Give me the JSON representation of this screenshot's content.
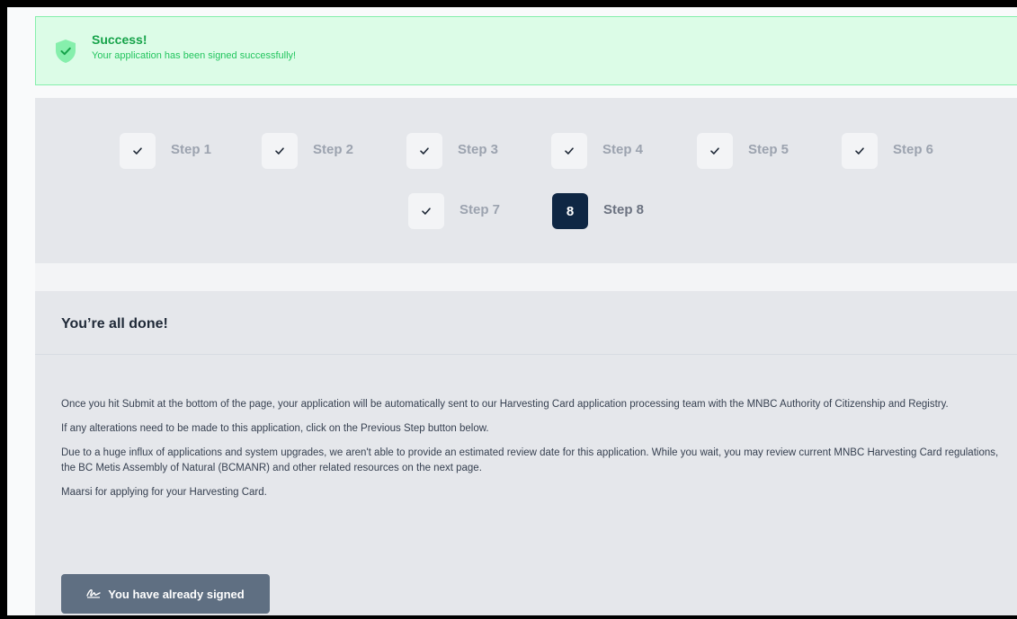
{
  "alert": {
    "title": "Success!",
    "message": "Your application has been signed successfully!",
    "icon": "shield-check-icon"
  },
  "steps": [
    {
      "label": "Step 1",
      "status": "complete"
    },
    {
      "label": "Step 2",
      "status": "complete"
    },
    {
      "label": "Step 3",
      "status": "complete"
    },
    {
      "label": "Step 4",
      "status": "complete"
    },
    {
      "label": "Step 5",
      "status": "complete"
    },
    {
      "label": "Step 6",
      "status": "complete"
    },
    {
      "label": "Step 7",
      "status": "complete"
    },
    {
      "label": "Step 8",
      "status": "current",
      "number": "8"
    }
  ],
  "done": {
    "title": "You’re all done!",
    "paragraphs": [
      "Once you hit Submit at the bottom of the page, your application will be automatically sent to our Harvesting Card application processing team with the MNBC Authority of Citizenship and Registry.",
      "If any alterations need to be made to this application, click on the Previous Step button below.",
      "Due to a huge influx of applications and system upgrades, we aren't able to provide an estimated review date for this application. While you wait, you may review current MNBC Harvesting Card regulations, the BC Metis Assembly of Natural (BCMANR) and other related resources on the next page.",
      "Maarsi for applying for your Harvesting Card."
    ],
    "signed_button": "You have already signed",
    "signed_icon": "signature-icon"
  },
  "colors": {
    "success_bg": "#dcfce7",
    "success_text": "#16a34a",
    "active_step": "#0f2744",
    "button": "#5f6f82"
  }
}
